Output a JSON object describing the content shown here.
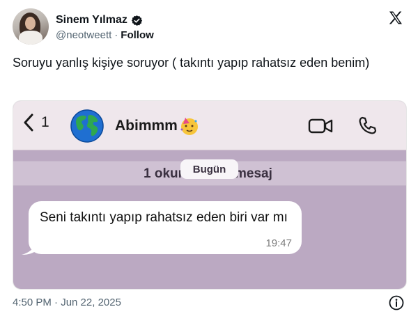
{
  "tweet": {
    "author_name": "Sinem Yılmaz",
    "handle": "@neotweett",
    "separator": "·",
    "follow_label": "Follow",
    "text": "Soruyu yanlış kişiye soruyor ( takıntı yapıp rahatsız eden benim)",
    "timestamp": "4:50 PM · Jun 22, 2025"
  },
  "chat": {
    "back_count": "1",
    "contact_name": "Abimmm",
    "unread_left": "1 okur",
    "unread_right": "mesaj",
    "date_label": "Bugün",
    "message_text": "Seni takıntı yapıp rahatsız eden biri var mı",
    "message_time": "19:47"
  },
  "colors": {
    "accent": "#1d9bf0",
    "chat_background": "#bba9c2",
    "chat_header": "#efe7ec"
  },
  "icons": [
    "verified-badge-icon",
    "x-logo-icon",
    "back-chevron-icon",
    "globe-icon",
    "party-face-icon",
    "video-call-icon",
    "phone-call-icon",
    "info-icon"
  ]
}
